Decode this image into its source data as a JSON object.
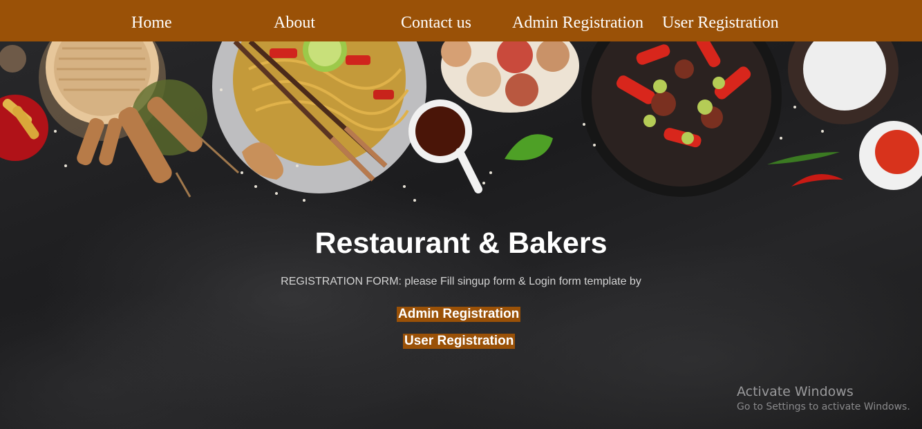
{
  "nav": {
    "items": [
      {
        "label": "Home"
      },
      {
        "label": "About"
      },
      {
        "label": "Contact us"
      },
      {
        "label": "Admin Registration"
      },
      {
        "label": "User Registration"
      }
    ]
  },
  "hero": {
    "title": "Restaurant & Bakers",
    "subtitle": "REGISTRATION FORM: please Fill singup form & Login form template by",
    "admin_button": "Admin Registration",
    "user_button": "User Registration"
  },
  "watermark": {
    "title": "Activate Windows",
    "subtitle": "Go to Settings to activate Windows."
  },
  "colors": {
    "nav_bg": "#9a5107",
    "button_bg": "#9a5107",
    "page_bg": "#1f1f20"
  }
}
